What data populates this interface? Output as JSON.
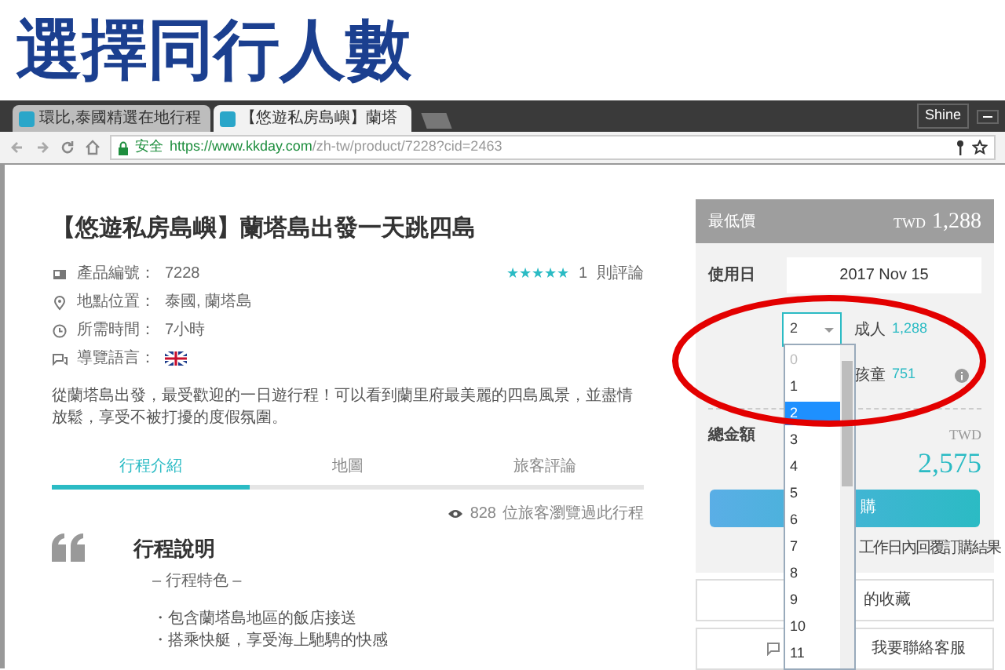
{
  "banner": {
    "title": "選擇同行人數"
  },
  "browser": {
    "tabs": [
      {
        "label": "環比,泰國精選在地行程",
        "selected": false
      },
      {
        "label": "【悠遊私房島嶼】蘭塔",
        "selected": true
      }
    ],
    "user": "Shine",
    "security_label": "安全",
    "url_host": "https://www.kkday.com",
    "url_path": "/zh-tw/product/7228?cid=2463"
  },
  "product": {
    "title": "【悠遊私房島嶼】蘭塔島出發一天跳四島",
    "stars": 5,
    "review_count": "1",
    "review_label": "則評論",
    "details": [
      {
        "kind": "id",
        "label": "產品編號：",
        "value": "7228"
      },
      {
        "kind": "location",
        "label": "地點位置：",
        "value": "泰國, 蘭塔島"
      },
      {
        "kind": "time",
        "label": "所需時間：",
        "value": "7小時"
      },
      {
        "kind": "language",
        "label": "導覽語言："
      }
    ],
    "description": "從蘭塔島出發，最受歡迎的一日遊行程！可以看到蘭里府最美麗的四島風景，並盡情放鬆，享受不被打擾的度假氛圍。",
    "tabs": [
      {
        "label": "行程介紹",
        "selected": true
      },
      {
        "label": "地圖",
        "selected": false
      },
      {
        "label": "旅客評論",
        "selected": false
      }
    ],
    "views": "828",
    "views_label": "位旅客瀏覽過此行程",
    "section_title": "行程說明",
    "section_subtitle": "– 行程特色 –",
    "bullets": [
      "・包含蘭塔島地區的飯店接送",
      "・搭乘快艇，享受海上馳騁的快感"
    ]
  },
  "booking": {
    "lowest_label": "最低價",
    "currency": "TWD",
    "lowest_price": "1,288",
    "date_label": "使用日",
    "date": "2017 Nov 15",
    "quantities": [
      {
        "label": "成人",
        "price": "1,288",
        "value": "2"
      },
      {
        "label": "孩童",
        "price": "751"
      }
    ],
    "total_label": "總金額",
    "total_currency": "TWD",
    "total": "2,575",
    "book_button": "購",
    "note": "工作日內回覆訂購結果",
    "links": [
      {
        "kind": "favorite",
        "label": "的收藏"
      },
      {
        "kind": "chat",
        "label": "我要聯絡客服"
      }
    ]
  },
  "dropdown": {
    "options": [
      {
        "label": "0",
        "selected": false,
        "disabled": true
      },
      {
        "label": "1",
        "selected": false,
        "disabled": false
      },
      {
        "label": "2",
        "selected": true,
        "disabled": false
      },
      {
        "label": "3",
        "selected": false,
        "disabled": false
      },
      {
        "label": "4",
        "selected": false,
        "disabled": false
      },
      {
        "label": "5",
        "selected": false,
        "disabled": false
      },
      {
        "label": "6",
        "selected": false,
        "disabled": false
      },
      {
        "label": "7",
        "selected": false,
        "disabled": false
      },
      {
        "label": "8",
        "selected": false,
        "disabled": false
      },
      {
        "label": "9",
        "selected": false,
        "disabled": false
      },
      {
        "label": "10",
        "selected": false,
        "disabled": false
      },
      {
        "label": "11",
        "selected": false,
        "disabled": false
      }
    ]
  }
}
